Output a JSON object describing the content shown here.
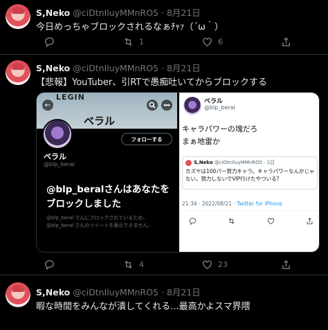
{
  "tweets": [
    {
      "name": "S,Neko",
      "handle": "@ciDtnIluyMMnRO5",
      "sep": "·",
      "date": "8月21日",
      "text": "今日めっちゃブロックされるなぁﾁｬｧ（´ω｀）",
      "reply_count": "",
      "retweet_count": "1",
      "like_count": "6"
    },
    {
      "name": "S,Neko",
      "handle": "@ciDtnIluyMMnRO5",
      "sep": "·",
      "date": "8月21日",
      "text": "【悲報】YouTuber、引RTで愚痴吐いてからブロックする",
      "reply_count": "",
      "retweet_count": "4",
      "like_count": "23"
    },
    {
      "name": "S,Neko",
      "handle": "@ciDtnIluyMMnRO5",
      "sep": "·",
      "date": "8月21日",
      "text": "暇な時間をみんなが潰してくれる...最高かよスマ界隈"
    }
  ],
  "media": {
    "left": {
      "banner_title": "ベラル",
      "banner_logo": "LEGIN",
      "back_glyph": "←",
      "follow_label": "フォローする",
      "profile_name": "ベラル",
      "profile_handle": "@blp_beral",
      "blocked_title": "@blp_beralさんはあなたをブロックしました",
      "blocked_desc": "@blp_beral さんにブロックされているため、@blp_beral さんのツイートを表示できません。"
    },
    "right": {
      "name": "ベラル",
      "handle": "@blp_beral",
      "line1": "キャラパワーの塊だろ",
      "line2": "まぁ地雷か",
      "quote_name": "S,Neko",
      "quote_meta": "@ciDtnIluyMMnRO5 · 1日",
      "quote_text": "カズヤは100パー努力キャラ。キャラパワーなんかじゃない。努力しないでVIP行けたやついる？",
      "time": "21:34 · 2022/08/21 · ",
      "source": "Twitter for iPhone"
    }
  },
  "colors": {
    "background": "#000000",
    "muted": "#71767b",
    "divider": "#2f3336",
    "link": "#1d9bf0"
  },
  "icons": [
    "reply-icon",
    "retweet-icon",
    "like-icon",
    "share-icon",
    "search-icon",
    "more-icon",
    "back-icon"
  ]
}
